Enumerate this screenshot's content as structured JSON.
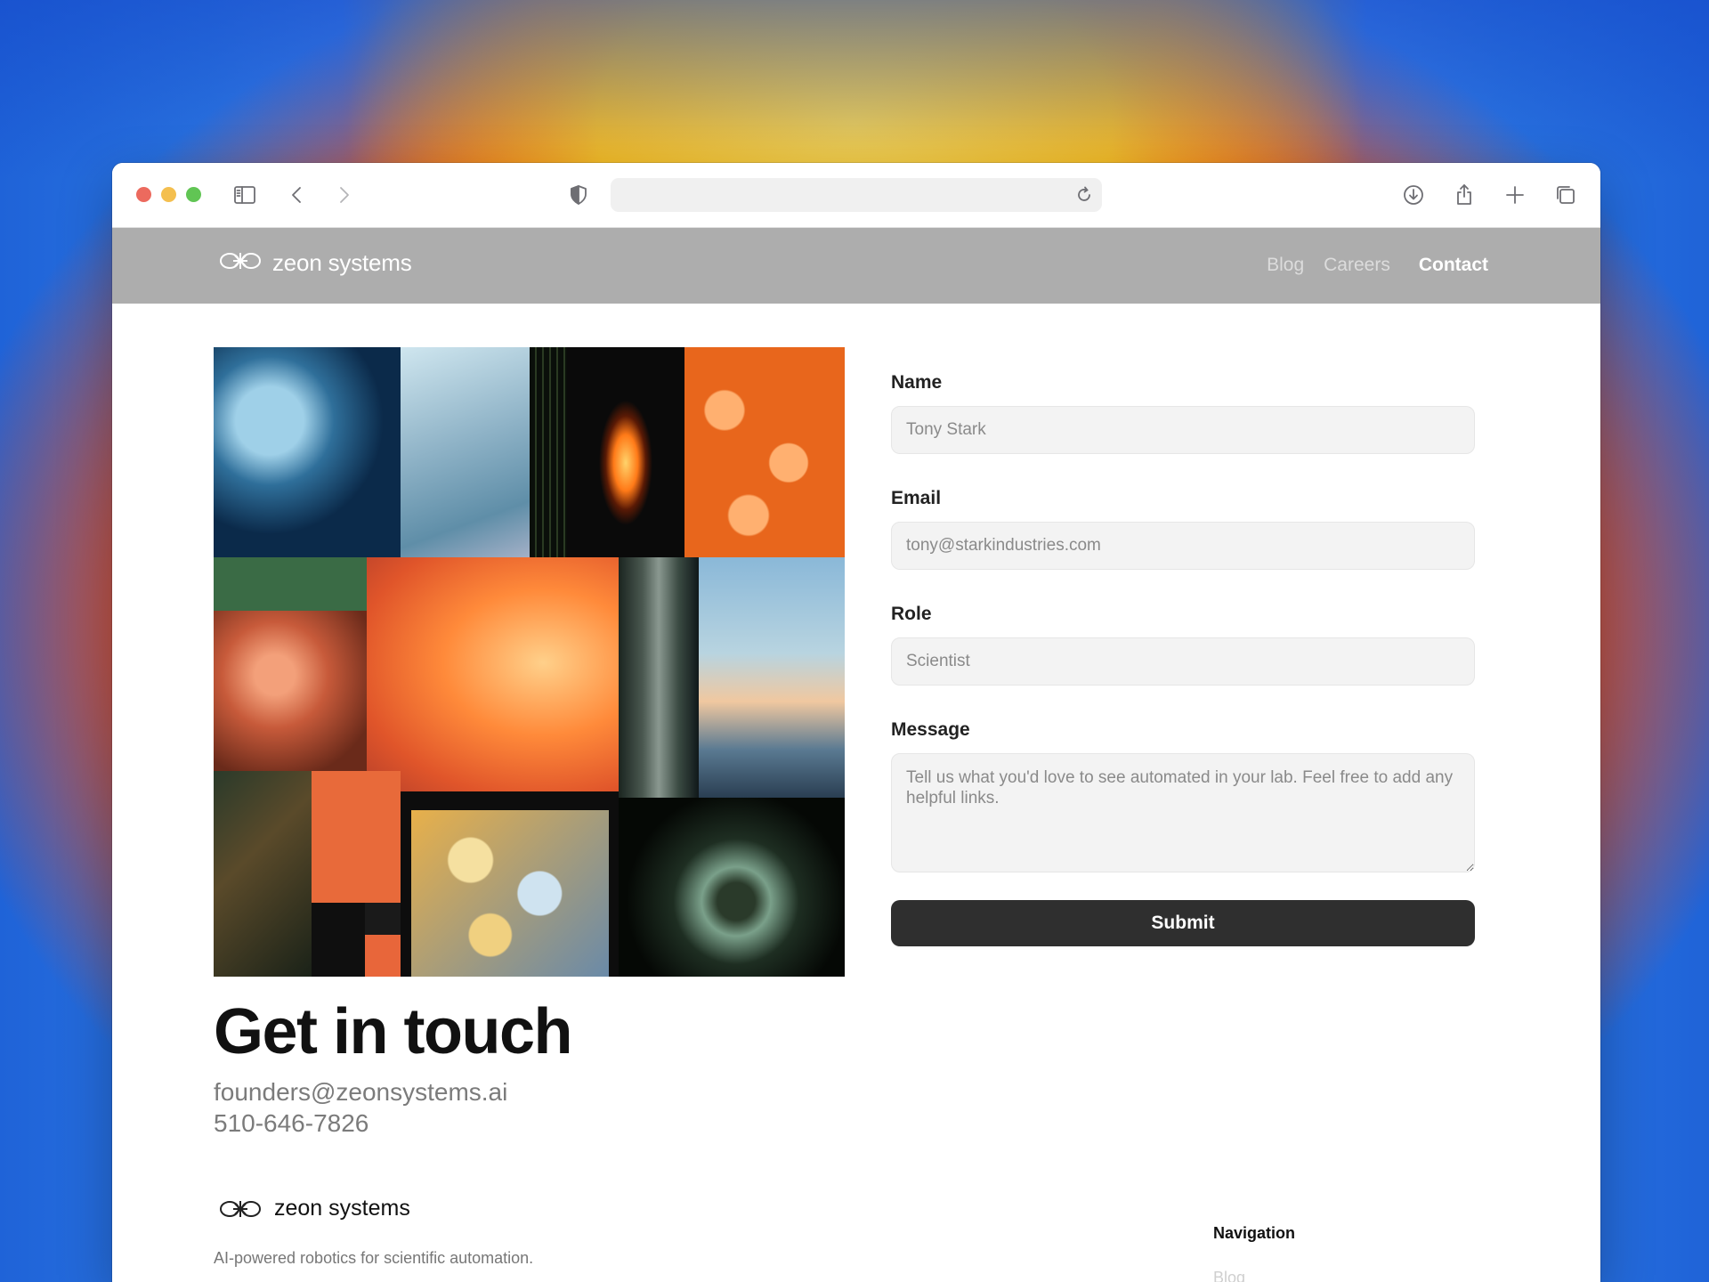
{
  "browser": {
    "url": "",
    "icons": [
      "sidebar-icon",
      "back-icon",
      "forward-icon",
      "shield-icon",
      "reload-icon",
      "download-icon",
      "share-icon",
      "new-tab-icon",
      "tabs-overview-icon"
    ]
  },
  "header": {
    "brand": "zeon systems",
    "nav": [
      {
        "label": "Blog"
      },
      {
        "label": "Careers"
      },
      {
        "label": "Contact",
        "active": true
      }
    ]
  },
  "contact": {
    "title": "Get in touch",
    "email": "founders@zeonsystems.ai",
    "phone": "510-646-7826"
  },
  "form": {
    "name": {
      "label": "Name",
      "placeholder": "Tony Stark"
    },
    "email": {
      "label": "Email",
      "placeholder": "tony@starkindustries.com"
    },
    "role": {
      "label": "Role",
      "placeholder": "Scientist"
    },
    "message": {
      "label": "Message",
      "placeholder": "Tell us what you'd love to see automated in your lab. Feel free to add any helpful links."
    },
    "submit_label": "Submit"
  },
  "footer": {
    "brand": "zeon systems",
    "tagline": "AI-powered robotics for scientific automation.",
    "nav_title": "Navigation",
    "nav_items": [
      "Blog"
    ]
  },
  "colors": {
    "header_bg": "#adadad",
    "button_bg": "#2f2f2f",
    "field_bg": "#f3f3f3"
  }
}
